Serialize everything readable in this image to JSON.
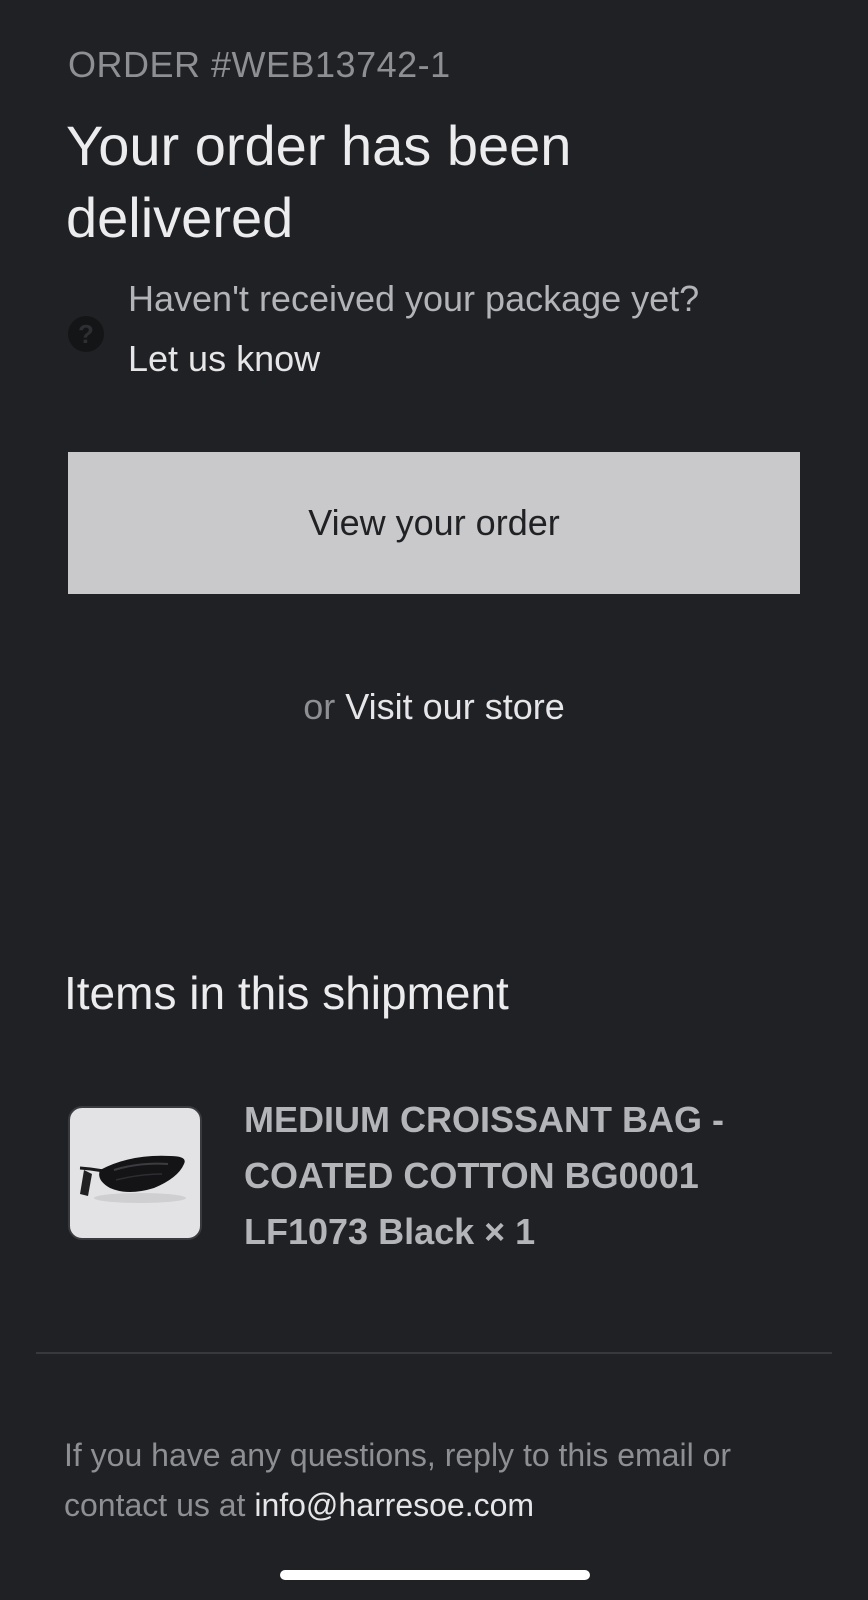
{
  "order": {
    "number_label": "ORDER #WEB13742-1",
    "headline": "Your order has been delivered"
  },
  "help": {
    "icon": "question-circle-icon",
    "question": "Haven't received your package yet?",
    "link": "Let us know"
  },
  "actions": {
    "view_order_label": "View your order",
    "or_text": "or",
    "visit_store_label": "Visit our store"
  },
  "shipment": {
    "title": "Items in this shipment",
    "items": [
      {
        "thumbnail": "black-croissant-bag-image",
        "name": "MEDIUM CROISSANT BAG - COATED COTTON BG0001 LF1073 Black × 1"
      }
    ]
  },
  "footer": {
    "text": "If you have any questions, reply to this email or contact us at",
    "email": "info@harresoe.com"
  },
  "colors": {
    "background": "#202124",
    "button": "#c9c9cb",
    "muted_text": "#8e8f93",
    "primary_text": "#ececee"
  }
}
